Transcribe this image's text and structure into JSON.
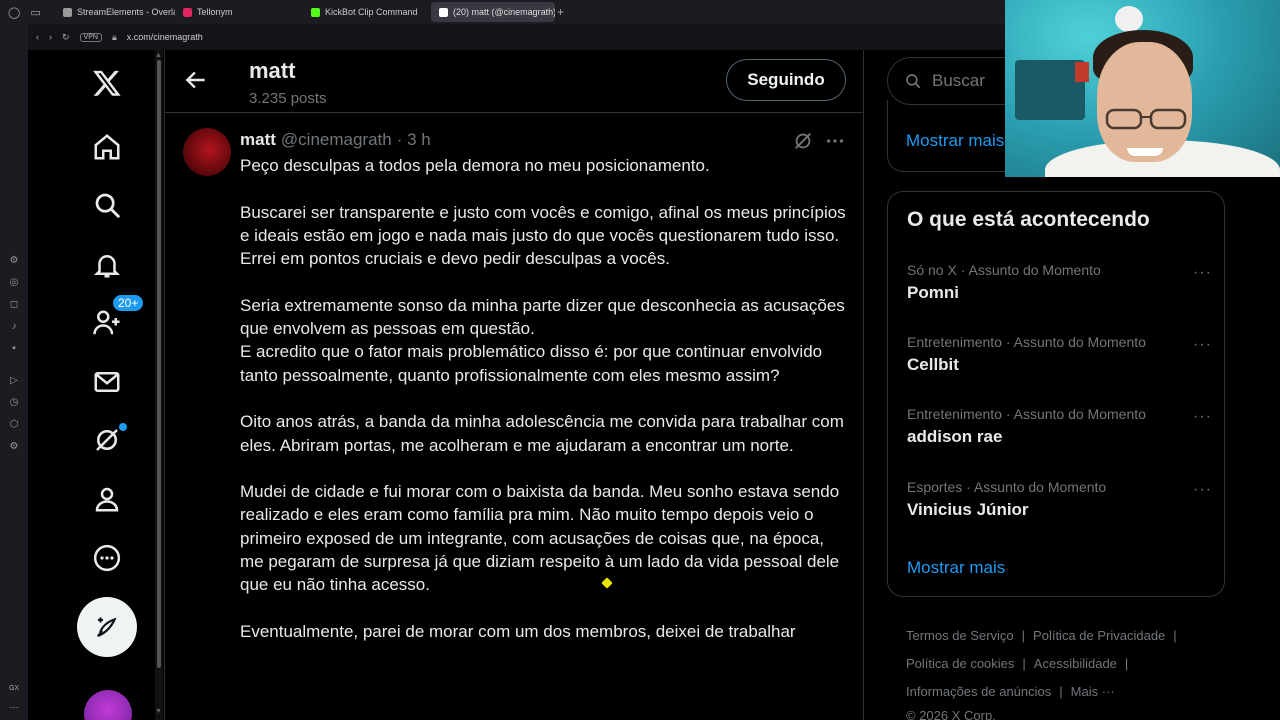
{
  "browser": {
    "tabs": [
      {
        "label": "StreamElements - Overlay",
        "color": "#9b9b9b"
      },
      {
        "label": "Tellonym",
        "color": "#e0245e"
      },
      {
        "label": "KickBot Clip Command",
        "color": "#53fc18"
      },
      {
        "label": "(20) matt (@cinemagrath)",
        "color": "#ffffff"
      }
    ],
    "vpn": "VPN",
    "url": "x.com/cinemagrath",
    "rail_gx": "GX",
    "rail_more": "···"
  },
  "nav": {
    "notifications_badge": "20+",
    "items": [
      "x-logo",
      "home",
      "explore",
      "notifications",
      "follow",
      "messages",
      "grok",
      "profile",
      "more",
      "post"
    ]
  },
  "header": {
    "name": "matt",
    "post_count": "3.235 posts",
    "follow_label": "Seguindo"
  },
  "post": {
    "display_name": "matt",
    "handle": "@cinemagrath",
    "time": "· 3 h",
    "paragraphs": [
      "Peço desculpas a todos pela demora no meu posicionamento.",
      "Buscarei ser transparente e justo com vocês e comigo, afinal os meus princípios e ideais estão em jogo e nada mais justo do que vocês questionarem tudo isso. Errei em pontos cruciais e devo pedir desculpas a vocês.",
      "Seria extremamente sonso da minha parte dizer que desconhecia as acusações que envolvem as pessoas em questão.",
      "E acredito que o fator mais problemático disso é: por que continuar envolvido tanto pessoalmente, quanto profissionalmente com eles mesmo assim?",
      "Oito anos atrás, a banda da minha adolescência me convida para trabalhar com eles. Abriram portas, me acolheram e me ajudaram a encontrar um norte.",
      "Mudei de cidade e fui morar com o baixista da banda. Meu sonho estava sendo realizado e eles eram como família pra mim. Não muito tempo depois veio o primeiro exposed de um integrante, com acusações de coisas que, na época, me pegaram de surpresa já que diziam respeito à um lado da vida pessoal dele que eu não tinha acesso.",
      "Eventualmente, parei de morar com um dos membros, deixei de trabalhar"
    ]
  },
  "sidebar": {
    "search_placeholder": "Buscar",
    "show_more_top": "Mostrar mais",
    "trends_title": "O que está acontecendo",
    "trends": [
      {
        "context": "Só no X · Assunto do Momento",
        "name": "Pomni"
      },
      {
        "context": "Entretenimento · Assunto do Momento",
        "name": "Cellbit"
      },
      {
        "context": "Entretenimento · Assunto do Momento",
        "name": "addison rae"
      },
      {
        "context": "Esportes · Assunto do Momento",
        "name": "Vinicius Júnior"
      }
    ],
    "show_more_trends": "Mostrar mais",
    "footer": {
      "terms": "Termos de Serviço",
      "privacy": "Política de Privacidade",
      "cookies": "Política de cookies",
      "accessibility": "Acessibilidade",
      "ads_info": "Informações de anúncios",
      "more": "Mais ···",
      "copyright": "© 2026 X Corp."
    }
  },
  "colors": {
    "accent": "#1d9bf0",
    "text": "#e7e9ea",
    "muted": "#71767b",
    "border": "#2f3336"
  }
}
